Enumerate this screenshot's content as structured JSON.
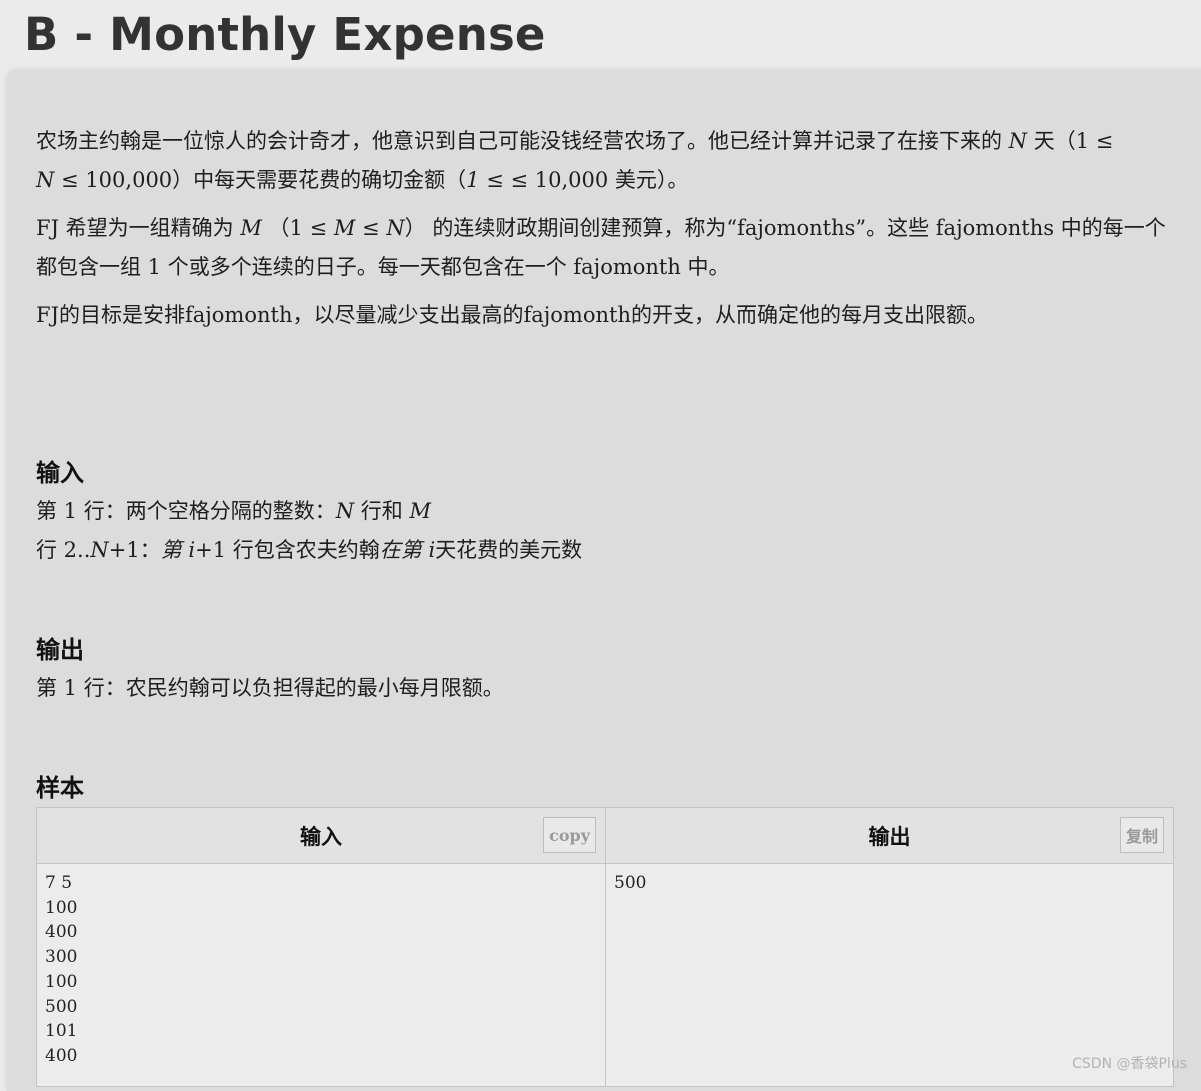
{
  "title": "B - Monthly Expense",
  "description": {
    "p1": {
      "t1": "农场主约翰是一位惊人的会计奇才，他意识到自己可能没钱经营农场了。他已经计算并记录了在接下来的 ",
      "n1": "N",
      "t2": " 天（1 ≤ ",
      "n2": "N",
      "t3": " ≤ 100,000）中每天需要花费的确切金额（",
      "n3": "1",
      "t4": " ≤ ≤ 10,000 美元）。"
    },
    "p2": {
      "t1": "FJ 希望为一组精确为 ",
      "m1": "M",
      "t2": " （1 ≤ ",
      "m2": "M",
      "t3": " ≤ ",
      "m3": "N",
      "t4": "） 的连续财政期间创建预算，称为“fajomonths”。这些 fajomonths 中的每一个都包含一组 1 个或多个连续的日子。每一天都包含在一个 fajomonth 中。"
    },
    "p3": "FJ的目标是安排fajomonth，以尽量减少支出最高的fajomonth的开支，从而确定他的每月支出限额。"
  },
  "input_section": {
    "heading": "输入",
    "line1": {
      "t1": "第 1 行：两个空格分隔的整数：",
      "n": "N",
      "t2": " 行和 ",
      "m": "M"
    },
    "line2": {
      "t1": "行 2..",
      "n": "N",
      "t2": "+1：",
      "it1": "第 i",
      "t3": "+1 行包含农夫约翰",
      "it2": "在第 i",
      "t4": "天花费的美元数"
    }
  },
  "output_section": {
    "heading": "输出",
    "line1": "第 1 行：农民约翰可以负担得起的最小每月限额。"
  },
  "sample": {
    "heading": "样本",
    "input_header": "输入",
    "output_header": "输出",
    "input_copy_label": "copy",
    "output_copy_label": "复制",
    "input_text": "7 5\n100\n400\n300\n100\n500\n101\n400",
    "output_text": "500"
  },
  "watermark": "CSDN @香袋Plus"
}
